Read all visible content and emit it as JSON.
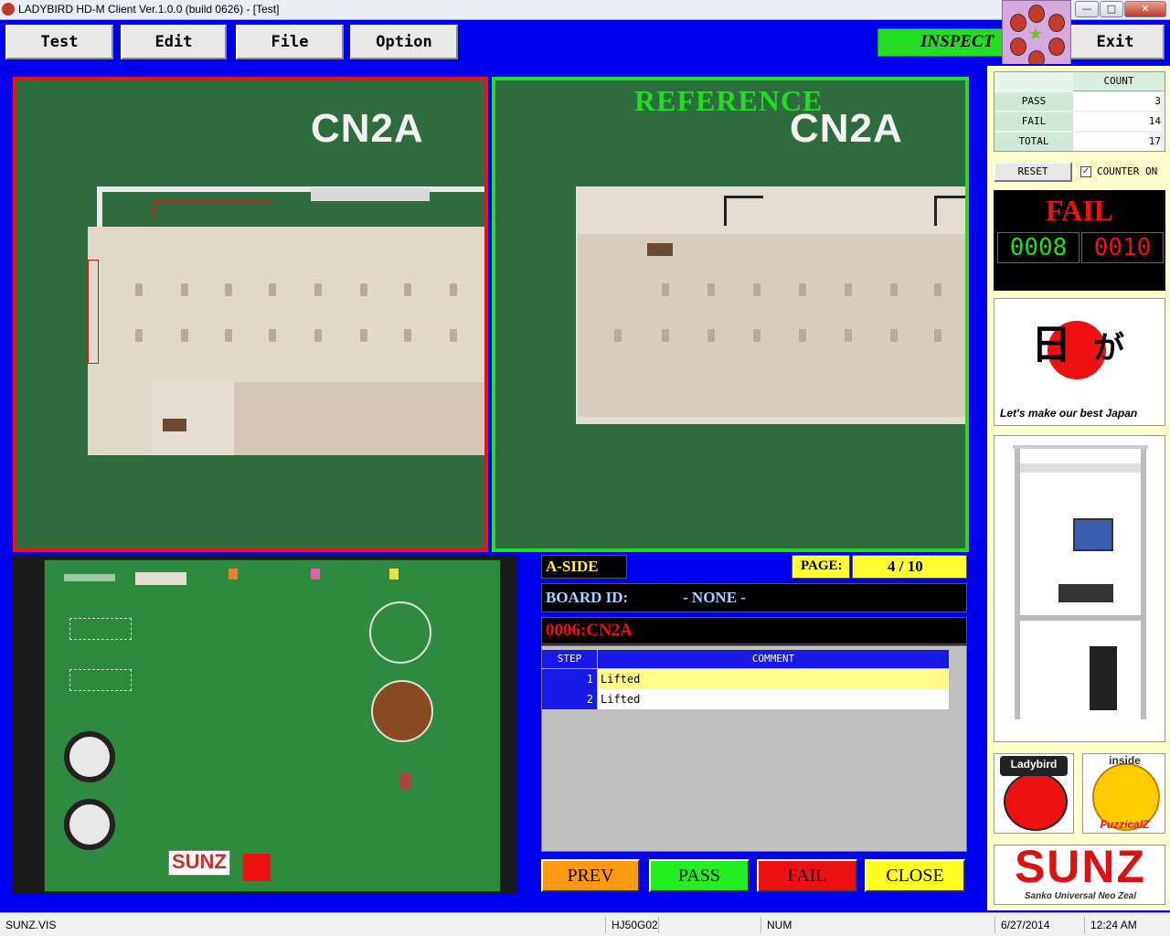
{
  "window": {
    "title": "LADYBIRD HD-M Client Ver.1.0.0  (build 0626) - [Test]",
    "controls": {
      "minimize": "—",
      "maximize": "□",
      "close": "✕"
    }
  },
  "menu": {
    "items": [
      {
        "label": "Test"
      },
      {
        "label": "Edit"
      },
      {
        "label": "File"
      },
      {
        "label": "Option"
      }
    ],
    "exit_label": "Exit",
    "inspect_label": "INSPECT"
  },
  "viewers": {
    "inspection_image_text": "CN2A",
    "reference_label": "REFERENCE",
    "reference_image_text": "CN2A"
  },
  "board_image": {
    "logo_text": "SUNZ"
  },
  "info": {
    "side": "A-SIDE",
    "page_label": "PAGE:",
    "page_value": "4 / 10",
    "board_id_label": "BOARD ID:",
    "board_id_value": "- NONE -",
    "component": "0006:CN2A"
  },
  "steps_table": {
    "headers": {
      "step": "STEP",
      "comment": "COMMENT"
    },
    "rows": [
      {
        "step": "1",
        "comment": "Lifted"
      },
      {
        "step": "2",
        "comment": "Lifted"
      }
    ]
  },
  "actions": {
    "prev": "PREV",
    "pass": "PASS",
    "fail": "FAIL",
    "close": "CLOSE"
  },
  "counter": {
    "header": "COUNT",
    "rows": [
      {
        "label": "PASS",
        "value": "3"
      },
      {
        "label": "FAIL",
        "value": "14"
      },
      {
        "label": "TOTAL",
        "value": "17"
      }
    ],
    "reset_label": "RESET",
    "counter_on_label": "COUNTER ON",
    "counter_on_checked": true
  },
  "status": {
    "result": "FAIL",
    "digit_left": "0008",
    "digit_right": "0010"
  },
  "branding": {
    "slogan": "Let's make our best Japan",
    "ladybird_label": "Ladybird",
    "inside_label": "inside",
    "fuzzical_label": "FuzzicalZ",
    "sunz_label": "SUNZ",
    "sunz_tagline": "Sanko Universal Neo Zeal"
  },
  "statusbar": {
    "file": "SUNZ.VIS",
    "model": "HJ50G02",
    "num": "NUM",
    "date": "6/27/2014",
    "time": "12:24 AM"
  },
  "colors": {
    "background": "#0000ee",
    "inspect_green": "#22dd22",
    "fail_red": "#ee1111",
    "reference_text": "#22dd22",
    "highlight_yellow": "#ffff88"
  }
}
